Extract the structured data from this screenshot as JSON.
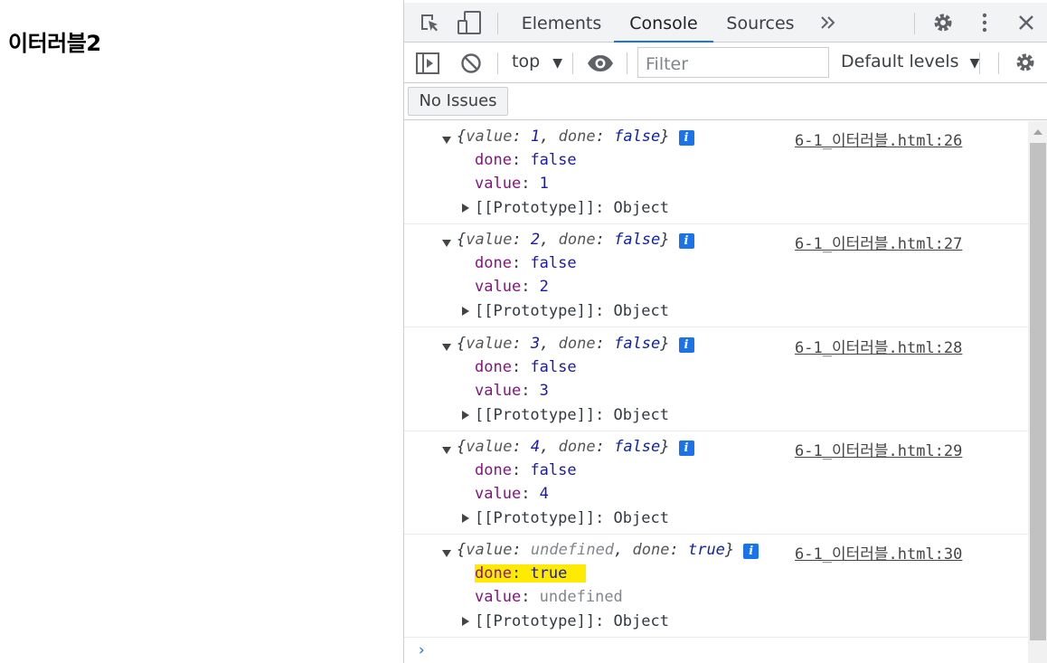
{
  "page": {
    "title": "이터러블2"
  },
  "devtools": {
    "tabs": [
      {
        "label": "Elements"
      },
      {
        "label": "Console",
        "active": true
      },
      {
        "label": "Sources"
      }
    ],
    "more_tabs_icon": "double-chevron-right",
    "toolbar": {
      "context": "top",
      "filter_placeholder": "Filter",
      "levels": "Default levels"
    },
    "issues_button": "No Issues",
    "colors": {
      "accent": "#1a73e8",
      "property_name": "#881280",
      "property_value": "#1a1aa6",
      "highlight": "#ffeb00"
    }
  },
  "console": {
    "messages": [
      {
        "summary_key1": "value",
        "summary_val1": "1",
        "summary_key2": "done",
        "summary_val2": "false",
        "source": "6-1_이터러블.html:26",
        "prop1_name": "done",
        "prop1_value": "false",
        "prop2_name": "value",
        "prop2_value": "1",
        "proto_label": "[[Prototype]]",
        "proto_value": "Object"
      },
      {
        "summary_key1": "value",
        "summary_val1": "2",
        "summary_key2": "done",
        "summary_val2": "false",
        "source": "6-1_이터러블.html:27",
        "prop1_name": "done",
        "prop1_value": "false",
        "prop2_name": "value",
        "prop2_value": "2",
        "proto_label": "[[Prototype]]",
        "proto_value": "Object"
      },
      {
        "summary_key1": "value",
        "summary_val1": "3",
        "summary_key2": "done",
        "summary_val2": "false",
        "source": "6-1_이터러블.html:28",
        "prop1_name": "done",
        "prop1_value": "false",
        "prop2_name": "value",
        "prop2_value": "3",
        "proto_label": "[[Prototype]]",
        "proto_value": "Object"
      },
      {
        "summary_key1": "value",
        "summary_val1": "4",
        "summary_key2": "done",
        "summary_val2": "false",
        "source": "6-1_이터러블.html:29",
        "prop1_name": "done",
        "prop1_value": "false",
        "prop2_name": "value",
        "prop2_value": "4",
        "proto_label": "[[Prototype]]",
        "proto_value": "Object"
      },
      {
        "summary_key1": "value",
        "summary_val1": "undefined",
        "summary_key2": "done",
        "summary_val2": "true",
        "source": "6-1_이터러블.html:30",
        "prop1_name": "done",
        "prop1_value": "true",
        "prop1_highlighted": true,
        "prop2_name": "value",
        "prop2_value": "undefined",
        "proto_label": "[[Prototype]]",
        "proto_value": "Object"
      }
    ],
    "prompt_symbol": "›"
  }
}
